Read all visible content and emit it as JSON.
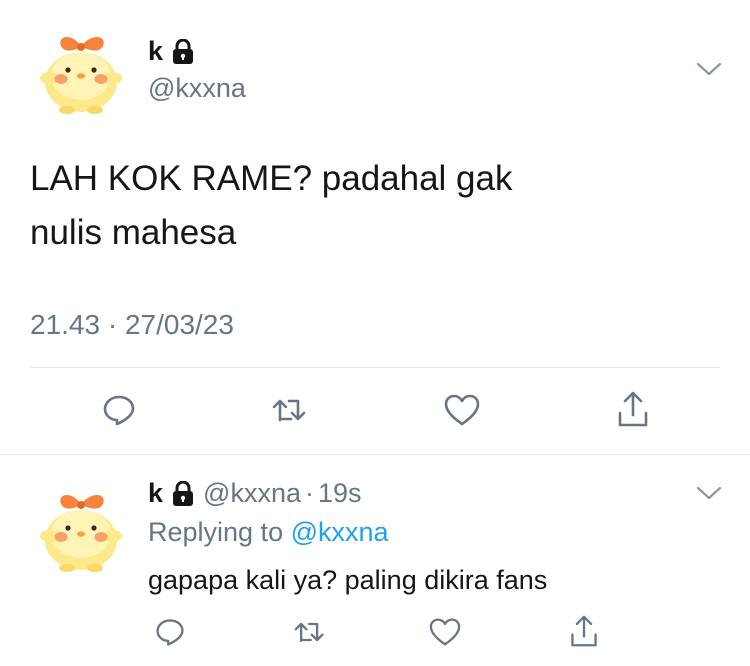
{
  "main_tweet": {
    "author_name": "k",
    "author_handle": "@kxxna",
    "text_line1": "LAH KOK RAME? padahal gak",
    "text_line2": "nulis mahesa",
    "timestamp": "21.43 · 27/03/23",
    "avatar_icon": "chick-avatar-icon",
    "lock_icon": "lock-icon"
  },
  "reply_tweet": {
    "author_name": "k",
    "author_handle": "@kxxna",
    "time_sep": "·",
    "time_ago": "19s",
    "replying_prefix": "Replying to",
    "replying_to": "@kxxna",
    "text": "gapapa kali ya? paling dikira fans"
  },
  "actions": [
    "reply-icon",
    "retweet-icon",
    "like-icon",
    "share-icon"
  ],
  "colors": {
    "text": "#14171a",
    "secondary": "#657786",
    "link": "#1da1f2",
    "divider": "#e1e8ed",
    "avatar_body": "#fde98a",
    "avatar_bow": "#f7823a",
    "avatar_cheek": "#f6a06a"
  }
}
